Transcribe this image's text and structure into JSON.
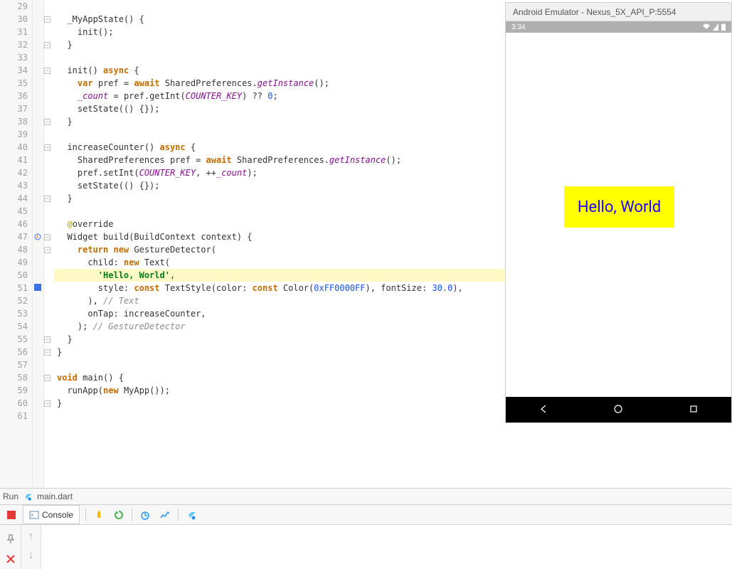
{
  "emulator": {
    "title": "Android Emulator - Nexus_5X_API_P:5554",
    "time": "3:34",
    "hello": "Hello, World"
  },
  "run": {
    "label": "Run",
    "file": "main.dart"
  },
  "console": {
    "label": "Console"
  },
  "lines": {
    "29": "",
    "30": "  _MyAppState() {",
    "31": "    init();",
    "32": "  }",
    "33": "",
    "34a": "  init() ",
    "34b": "async",
    "34c": " {",
    "35a": "    ",
    "35b": "var",
    "35c": " pref = ",
    "35d": "await",
    "35e": " SharedPreferences.",
    "35f": "getInstance",
    "35g": "();",
    "36a": "    ",
    "36b": "_count",
    "36c": " = pref.getInt(",
    "36d": "COUNTER_KEY",
    "36e": ") ?? ",
    "36f": "0",
    "36g": ";",
    "37": "    setState(() {});",
    "38": "  }",
    "39": "",
    "40a": "  increaseCounter() ",
    "40b": "async",
    "40c": " {",
    "41a": "    SharedPreferences pref = ",
    "41b": "await",
    "41c": " SharedPreferences.",
    "41d": "getInstance",
    "41e": "();",
    "42a": "    pref.setInt(",
    "42b": "COUNTER_KEY",
    "42c": ", ++",
    "42d": "_count",
    "42e": ");",
    "43": "    setState(() {});",
    "44": "  }",
    "45": "",
    "46a": "  ",
    "46b": "@",
    "46c": "override",
    "47": "  Widget build(BuildContext context) {",
    "48a": "    ",
    "48b": "return new",
    "48c": " GestureDetector(",
    "49a": "      child: ",
    "49b": "new",
    "49c": " Text(",
    "50a": "        ",
    "50b": "'Hello, World'",
    "50c": ",",
    "51a": "        style: ",
    "51b": "const",
    "51c": " TextStyle(color: ",
    "51d": "const",
    "51e": " Color(",
    "51f": "0xFF0000FF",
    "51g": "), fontSize: ",
    "51h": "30.0",
    "51i": "),",
    "52a": "      ), ",
    "52b": "// Text",
    "53": "      onTap: increaseCounter,",
    "54a": "    ); ",
    "54b": "// GestureDetector",
    "55": "  }",
    "56": "}",
    "57": "",
    "58a": "",
    "58b": "void",
    "58c": " main() {",
    "59a": "  runApp(",
    "59b": "new",
    "59c": " MyApp());",
    "60": "}",
    "61": ""
  },
  "line_numbers": [
    "29",
    "30",
    "31",
    "32",
    "33",
    "34",
    "35",
    "36",
    "37",
    "38",
    "39",
    "40",
    "41",
    "42",
    "43",
    "44",
    "45",
    "46",
    "47",
    "48",
    "49",
    "50",
    "51",
    "52",
    "53",
    "54",
    "55",
    "56",
    "57",
    "58",
    "59",
    "60",
    "61"
  ]
}
